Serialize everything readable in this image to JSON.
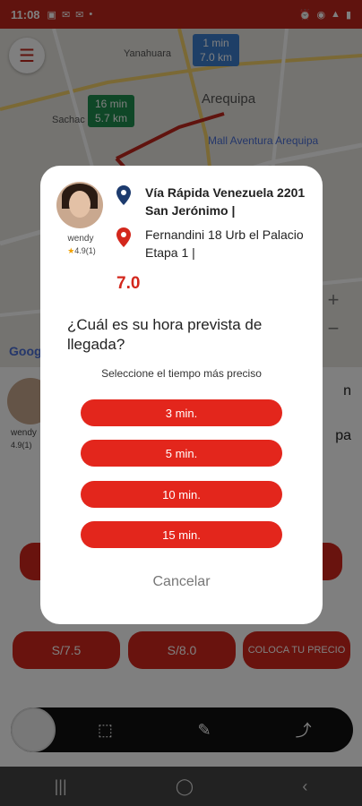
{
  "status_bar": {
    "time": "11:08"
  },
  "map": {
    "labels": [
      "Yanahuara",
      "Sachac",
      "Arequipa"
    ],
    "poi": "Mall Aventura Arequipa",
    "bubble_near": {
      "time": "1 min",
      "distance": "7.0 km",
      "color": "#3d7fcf"
    },
    "bubble_far": {
      "time": "16 min",
      "distance": "5.7 km",
      "color": "#1f8f4e"
    },
    "google_label": "Google"
  },
  "sheet": {
    "user_name": "wendy",
    "rating": "4.9(1)",
    "side_texts": [
      "n",
      "pa"
    ],
    "prices": [
      "S/7.5",
      "S/8.0",
      "COLOCA TU PRECIO"
    ]
  },
  "dialog": {
    "user_name": "wendy",
    "rating": "4.9(1)",
    "origin": "Vía Rápida Venezuela 2201 San Jerónimo |",
    "destination": "Fernandini 18 Urb el Palacio Etapa 1 |",
    "distance": "7.0",
    "question": "¿Cuál es su hora prevista de llegada?",
    "hint": "Seleccione el tiempo más preciso",
    "options": [
      "3 min.",
      "5 min.",
      "10 min.",
      "15 min."
    ],
    "cancel": "Cancelar"
  },
  "colors": {
    "accent": "#e3261c",
    "origin_pin": "#1d3b6e",
    "dest_pin": "#d3271c"
  }
}
